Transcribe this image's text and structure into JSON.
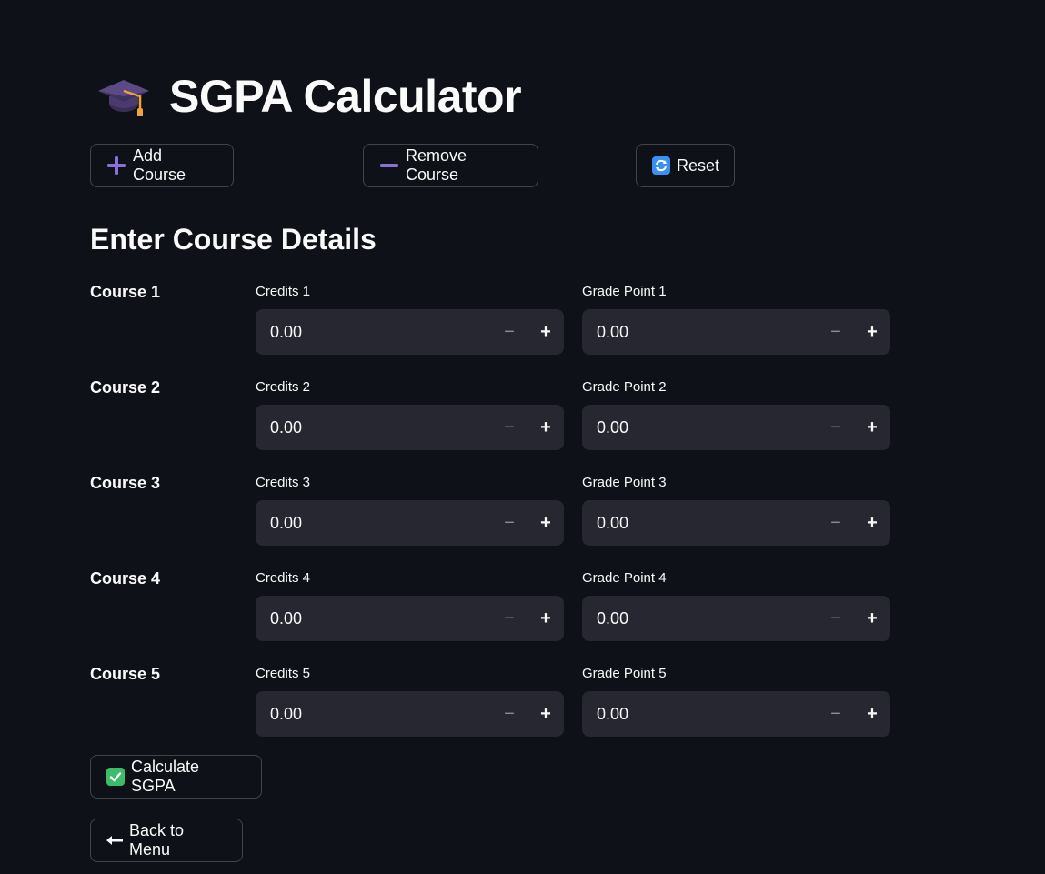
{
  "title": "SGPA Calculator",
  "title_icon": "graduation-cap-icon",
  "toolbar": {
    "add_label": "Add Course",
    "remove_label": "Remove Course",
    "reset_label": "Reset"
  },
  "section_heading": "Enter Course Details",
  "courses": [
    {
      "label": "Course 1",
      "credits_label": "Credits 1",
      "credits_value": "0.00",
      "grade_label": "Grade Point 1",
      "grade_value": "0.00"
    },
    {
      "label": "Course 2",
      "credits_label": "Credits 2",
      "credits_value": "0.00",
      "grade_label": "Grade Point 2",
      "grade_value": "0.00"
    },
    {
      "label": "Course 3",
      "credits_label": "Credits 3",
      "credits_value": "0.00",
      "grade_label": "Grade Point 3",
      "grade_value": "0.00"
    },
    {
      "label": "Course 4",
      "credits_label": "Credits 4",
      "credits_value": "0.00",
      "grade_label": "Grade Point 4",
      "grade_value": "0.00"
    },
    {
      "label": "Course 5",
      "credits_label": "Credits 5",
      "credits_value": "0.00",
      "grade_label": "Grade Point 5",
      "grade_value": "0.00"
    }
  ],
  "stepper": {
    "minus": "−",
    "plus": "+"
  },
  "calculate_label": "Calculate SGPA",
  "back_label": "Back to Menu",
  "colors": {
    "background": "#0e1117",
    "input_bg": "#262730",
    "accent_purple": "#7b5fc9",
    "check_green": "#3dbb6a",
    "reset_blue": "#3b8ff0"
  }
}
